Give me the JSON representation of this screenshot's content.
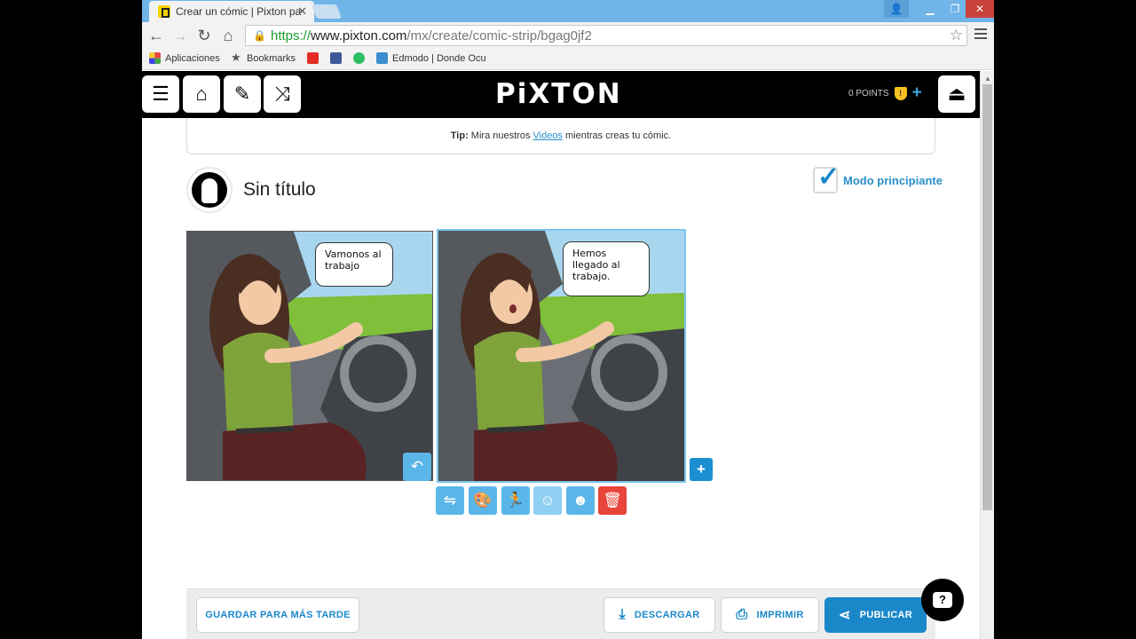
{
  "browser": {
    "tab_title": "Crear un cómic | Pixton pa",
    "tab_close": "✕",
    "url_scheme": "https://",
    "url_host": "www.pixton.com",
    "url_path": "/mx/create/comic-strip/bgag0jf2",
    "bookmarks": [
      {
        "label": "Aplicaciones",
        "icon": "apps-icon"
      },
      {
        "label": "Bookmarks",
        "icon": "star-icon"
      },
      {
        "label": "",
        "icon": "youtube-icon"
      },
      {
        "label": "",
        "icon": "facebook-icon"
      },
      {
        "label": "",
        "icon": "evernote-icon"
      },
      {
        "label": "Edmodo | Donde Ocu",
        "icon": "edmodo-icon"
      }
    ]
  },
  "app": {
    "logo": "PiXTON",
    "points": "0 POINTS",
    "shield_badge": "!"
  },
  "tip": {
    "prefix": "Tip:",
    "text_before": " Mira nuestros ",
    "link": "Videos",
    "text_after": " mientras creas tu cómic."
  },
  "comic": {
    "title": "Sin título",
    "beginner_mode": "Modo principiante",
    "beginner_mode_checked": true,
    "panels": [
      {
        "bubble": "Vamonos al trabajo"
      },
      {
        "bubble": "Hemos llegado al trabajo."
      }
    ]
  },
  "panel_tools": [
    {
      "name": "flip-icon",
      "glyph": "⇋"
    },
    {
      "name": "palette-icon",
      "glyph": "🎨"
    },
    {
      "name": "pose-icon",
      "glyph": "🏃"
    },
    {
      "name": "face-icon",
      "glyph": "☺"
    },
    {
      "name": "head-icon",
      "glyph": "☻"
    },
    {
      "name": "trash-icon",
      "glyph": "🗑"
    }
  ],
  "footer": {
    "save_later": "GUARDAR PARA MÁS TARDE",
    "download": "DESCARGAR",
    "print": "IMPRIMIR",
    "publish": "PUBLICAR"
  },
  "colors": {
    "accent": "#1a87c9",
    "tool_button": "#5ab6e8",
    "delete_button": "#e8443a"
  }
}
